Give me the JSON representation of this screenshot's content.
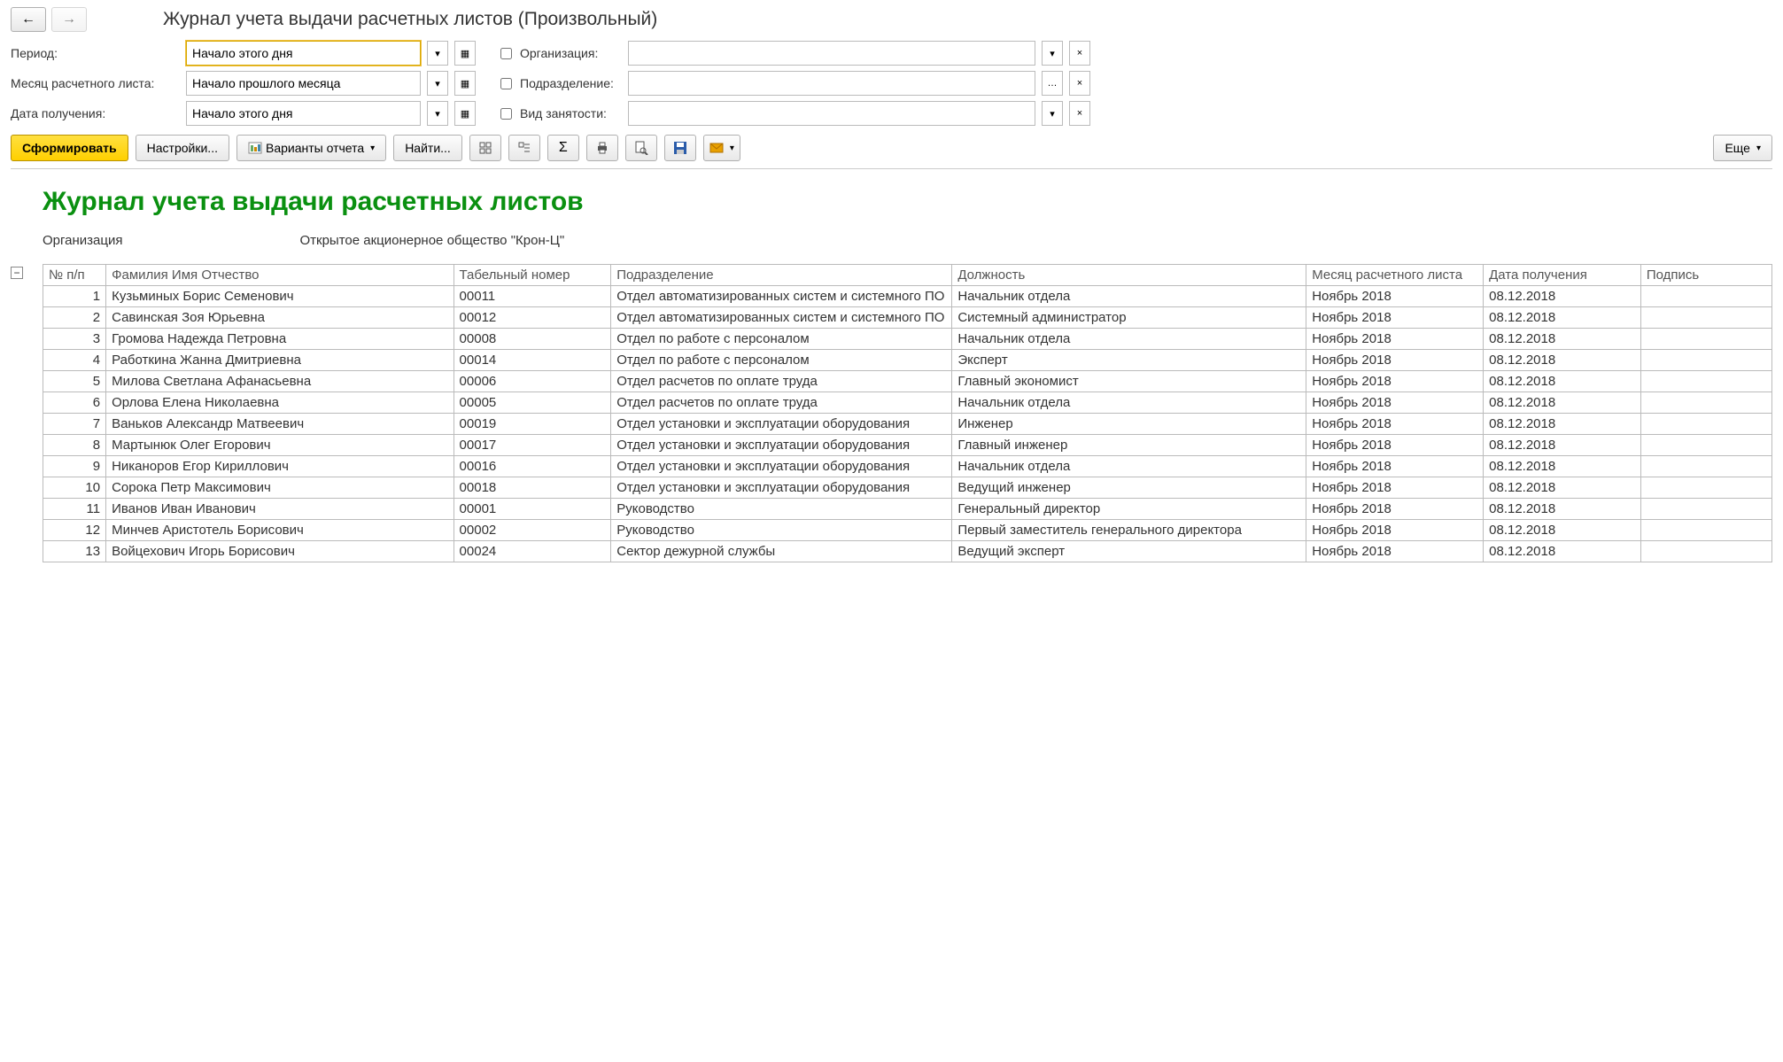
{
  "header": {
    "title": "Журнал учета выдачи расчетных листов (Произвольный)"
  },
  "filters": {
    "period_label": "Период:",
    "period_value": "Начало этого дня",
    "sheet_month_label": "Месяц расчетного листа:",
    "sheet_month_value": "Начало прошлого месяца",
    "receive_date_label": "Дата получения:",
    "receive_date_value": "Начало этого дня",
    "organization_label": "Организация:",
    "organization_value": "",
    "department_label": "Подразделение:",
    "department_value": "",
    "employment_label": "Вид занятости:",
    "employment_value": ""
  },
  "toolbar": {
    "generate_label": "Сформировать",
    "settings_label": "Настройки...",
    "variants_label": "Варианты отчета",
    "find_label": "Найти...",
    "more_label": "Еще"
  },
  "report": {
    "title": "Журнал учета выдачи расчетных листов",
    "org_label": "Организация",
    "org_value": "Открытое акционерное общество \"Крон-Ц\"",
    "columns": {
      "num": "№ п/п",
      "fio": "Фамилия Имя Отчество",
      "tab": "Табельный номер",
      "dept": "Подразделение",
      "pos": "Должность",
      "month": "Месяц расчетного листа",
      "date": "Дата получения",
      "sign": "Подпись"
    },
    "rows": [
      {
        "num": "1",
        "fio": "Кузьминых Борис Семенович",
        "tab": "00011",
        "dept": "Отдел автоматизированных систем и системного ПО",
        "pos": "Начальник отдела",
        "month": "Ноябрь 2018",
        "date": "08.12.2018"
      },
      {
        "num": "2",
        "fio": "Савинская Зоя Юрьевна",
        "tab": "00012",
        "dept": "Отдел автоматизированных систем и системного ПО",
        "pos": "Системный администратор",
        "month": "Ноябрь 2018",
        "date": "08.12.2018"
      },
      {
        "num": "3",
        "fio": "Громова Надежда Петровна",
        "tab": "00008",
        "dept": "Отдел по работе с персоналом",
        "pos": "Начальник отдела",
        "month": "Ноябрь 2018",
        "date": "08.12.2018"
      },
      {
        "num": "4",
        "fio": "Работкина Жанна Дмитриевна",
        "tab": "00014",
        "dept": "Отдел по работе с персоналом",
        "pos": "Эксперт",
        "month": "Ноябрь 2018",
        "date": "08.12.2018"
      },
      {
        "num": "5",
        "fio": "Милова Светлана Афанасьевна",
        "tab": "00006",
        "dept": "Отдел расчетов по оплате труда",
        "pos": "Главный экономист",
        "month": "Ноябрь 2018",
        "date": "08.12.2018"
      },
      {
        "num": "6",
        "fio": "Орлова Елена Николаевна",
        "tab": "00005",
        "dept": "Отдел расчетов по оплате труда",
        "pos": "Начальник отдела",
        "month": "Ноябрь 2018",
        "date": "08.12.2018"
      },
      {
        "num": "7",
        "fio": "Ваньков Александр Матвеевич",
        "tab": "00019",
        "dept": "Отдел установки и эксплуатации оборудования",
        "pos": "Инженер",
        "month": "Ноябрь 2018",
        "date": "08.12.2018"
      },
      {
        "num": "8",
        "fio": "Мартынюк Олег Егорович",
        "tab": "00017",
        "dept": "Отдел установки и эксплуатации оборудования",
        "pos": "Главный инженер",
        "month": "Ноябрь 2018",
        "date": "08.12.2018"
      },
      {
        "num": "9",
        "fio": "Никаноров Егор Кириллович",
        "tab": "00016",
        "dept": "Отдел установки и эксплуатации оборудования",
        "pos": "Начальник отдела",
        "month": "Ноябрь 2018",
        "date": "08.12.2018"
      },
      {
        "num": "10",
        "fio": "Сорока Петр Максимович",
        "tab": "00018",
        "dept": "Отдел установки и эксплуатации оборудования",
        "pos": "Ведущий инженер",
        "month": "Ноябрь 2018",
        "date": "08.12.2018"
      },
      {
        "num": "11",
        "fio": "Иванов Иван Иванович",
        "tab": "00001",
        "dept": "Руководство",
        "pos": "Генеральный директор",
        "month": "Ноябрь 2018",
        "date": "08.12.2018"
      },
      {
        "num": "12",
        "fio": "Минчев Аристотель Борисович",
        "tab": "00002",
        "dept": "Руководство",
        "pos": "Первый заместитель генерального директора",
        "month": "Ноябрь 2018",
        "date": "08.12.2018"
      },
      {
        "num": "13",
        "fio": "Войцехович Игорь Борисович",
        "tab": "00024",
        "dept": "Сектор дежурной службы",
        "pos": "Ведущий эксперт",
        "month": "Ноябрь 2018",
        "date": "08.12.2018"
      }
    ]
  }
}
